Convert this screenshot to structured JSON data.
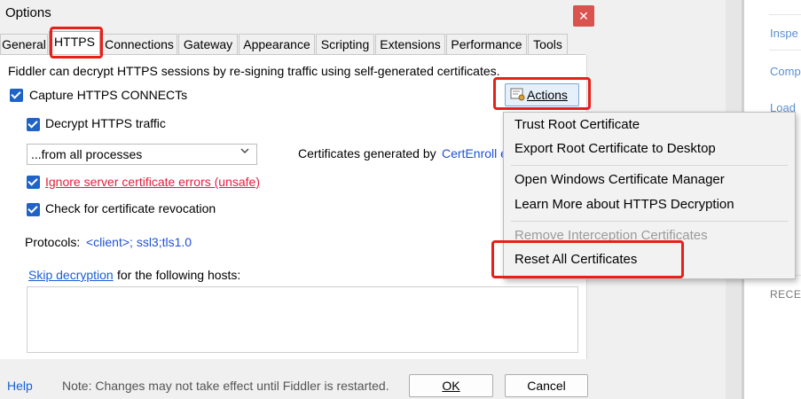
{
  "background": {
    "links": [
      "Inspe",
      "Comp",
      "Load"
    ],
    "recent_label": "RECE"
  },
  "dialog": {
    "title": "Options",
    "close_glyph": "✕",
    "tabs": [
      "General",
      "HTTPS",
      "Connections",
      "Gateway",
      "Appearance",
      "Scripting",
      "Extensions",
      "Performance",
      "Tools"
    ],
    "active_tab": "HTTPS"
  },
  "https": {
    "description": "Fiddler can decrypt HTTPS sessions by re-signing traffic using self-generated certificates.",
    "capture_label": "Capture HTTPS CONNECTs",
    "capture_checked": true,
    "decrypt_label": "Decrypt HTTPS traffic",
    "decrypt_checked": true,
    "process_select_value": "...from all processes",
    "cert_generated_label": "Certificates generated by",
    "cert_generator_link": "CertEnroll e",
    "ignore_errors_label": "Ignore server certificate errors (unsafe)",
    "ignore_errors_checked": true,
    "revocation_label": "Check for certificate revocation",
    "revocation_checked": true,
    "protocols_label": "Protocols:",
    "protocols_value": "<client>; ssl3;tls1.0",
    "skip_link": "Skip decryption",
    "skip_suffix": "for the following hosts:",
    "skip_hosts_value": "",
    "actions_button": "Actions"
  },
  "footer": {
    "help_link": "Help",
    "note": "Note: Changes may not take effect until Fiddler is restarted.",
    "ok_button": "OK",
    "cancel_button": "Cancel"
  },
  "actions_menu": {
    "items": [
      {
        "label": "Trust Root Certificate",
        "enabled": true
      },
      {
        "label": "Export Root Certificate to Desktop",
        "enabled": true
      },
      {
        "label": "Open Windows Certificate Manager",
        "enabled": true
      },
      {
        "label": "Learn More about HTTPS Decryption",
        "enabled": true
      },
      {
        "label": "Remove Interception Certificates",
        "enabled": false
      },
      {
        "label": "Reset All Certificates",
        "enabled": true
      }
    ]
  },
  "colors": {
    "accent": "#1f63c6",
    "highlight_box": "#e8201a",
    "warning_text": "#e0203a",
    "link": "#1a5fd6"
  },
  "icons": [
    "close-icon",
    "checkbox-checked-icon",
    "chevron-down-icon",
    "certificate-icon"
  ]
}
